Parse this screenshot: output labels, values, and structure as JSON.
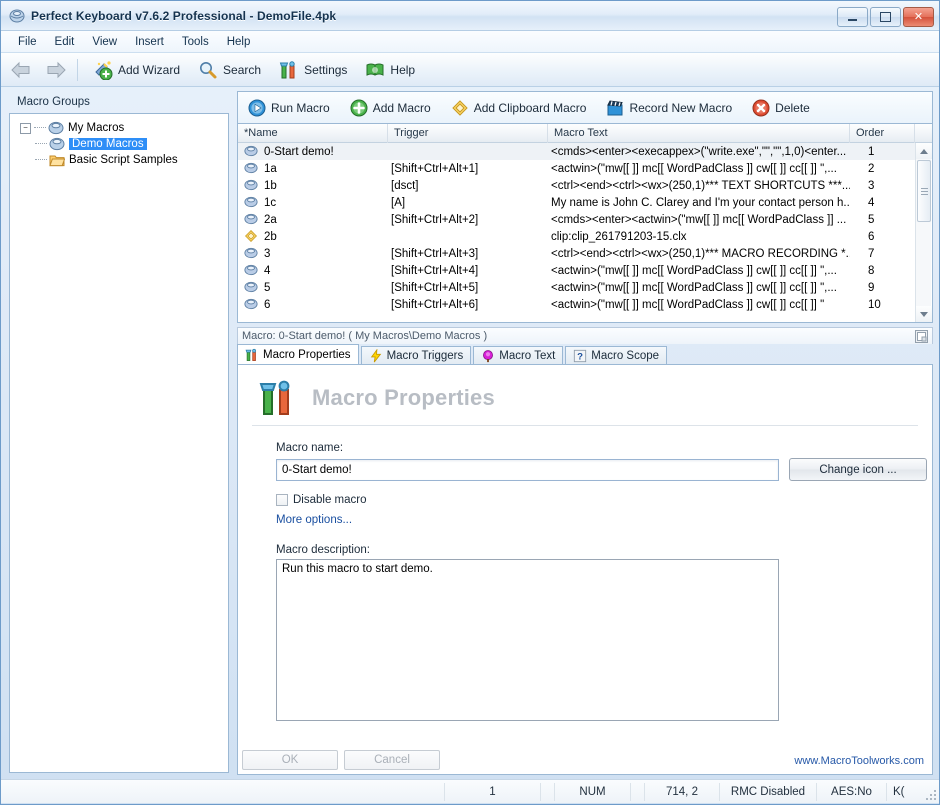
{
  "window": {
    "title": "Perfect Keyboard v7.6.2 Professional - DemoFile.4pk",
    "minimize_label": "Minimize",
    "maximize_label": "Maximize",
    "close_label": "✕"
  },
  "menu": {
    "items": [
      {
        "label": "File"
      },
      {
        "label": "Edit"
      },
      {
        "label": "View"
      },
      {
        "label": "Insert"
      },
      {
        "label": "Tools"
      },
      {
        "label": "Help"
      }
    ]
  },
  "toolbar": {
    "back_icon": "back-arrow-icon",
    "forward_icon": "forward-arrow-icon",
    "buttons": [
      {
        "label": "Add Wizard",
        "icon": "add-wizard-icon"
      },
      {
        "label": "Search",
        "icon": "magnifier-icon"
      },
      {
        "label": "Settings",
        "icon": "settings-tools-icon"
      },
      {
        "label": "Help",
        "icon": "help-book-icon"
      }
    ]
  },
  "sidebar": {
    "header": "Macro Groups",
    "tree": [
      {
        "label": "My Macros",
        "icon": "macro-group-icon",
        "level": 0,
        "expanded": true,
        "selected": false
      },
      {
        "label": "Demo Macros",
        "icon": "macro-group-icon",
        "level": 1,
        "expanded": false,
        "selected": true
      },
      {
        "label": "Basic Script Samples",
        "icon": "folder-icon",
        "level": 1,
        "expanded": false,
        "selected": false
      }
    ]
  },
  "list_toolbar": {
    "buttons": [
      {
        "label": "Run Macro",
        "icon": "play-icon"
      },
      {
        "label": "Add Macro",
        "icon": "add-plus-icon"
      },
      {
        "label": "Add Clipboard Macro",
        "icon": "clipboard-diamond-icon"
      },
      {
        "label": "Record New Macro",
        "icon": "record-clapper-icon"
      },
      {
        "label": "Delete",
        "icon": "delete-x-icon"
      }
    ]
  },
  "macro_list": {
    "columns": [
      "*Name",
      "Trigger",
      "Macro Text",
      "Order"
    ],
    "rows": [
      {
        "icon": "macro-cube-icon",
        "name": "0-Start demo!",
        "trigger": "",
        "text": "<cmds><enter><execappex>(\"write.exe\",\"\",\"\",1,0)<enter...",
        "order": "1",
        "selected": true
      },
      {
        "icon": "macro-cube-icon",
        "name": "1a",
        "trigger": "[Shift+Ctrl+Alt+1]",
        "text": "<actwin>(\"mw[[  ]] mc[[ WordPadClass ]] cw[[  ]] cc[[  ]] \",...",
        "order": "2",
        "selected": false
      },
      {
        "icon": "macro-cube-icon",
        "name": "1b",
        "trigger": "[dsct]",
        "text": "<ctrl><end><ctrl><wx>(250,1)*** TEXT SHORTCUTS ***...",
        "order": "3",
        "selected": false
      },
      {
        "icon": "macro-cube-icon",
        "name": "1c",
        "trigger": "[A]",
        "text": "My name is John C. Clarey and I'm your contact person h...",
        "order": "4",
        "selected": false
      },
      {
        "icon": "macro-cube-icon",
        "name": "2a",
        "trigger": "[Shift+Ctrl+Alt+2]",
        "text": "<cmds><enter><actwin>(\"mw[[  ]] mc[[ WordPadClass ]] ...",
        "order": "5",
        "selected": false
      },
      {
        "icon": "clipboard-diamond-icon",
        "name": "2b",
        "trigger": "",
        "text": "clip:clip_261791203-15.clx",
        "order": "6",
        "selected": false
      },
      {
        "icon": "macro-cube-icon",
        "name": "3",
        "trigger": "[Shift+Ctrl+Alt+3]",
        "text": "<ctrl><end><ctrl><wx>(250,1)*** MACRO RECORDING *...",
        "order": "7",
        "selected": false
      },
      {
        "icon": "macro-cube-icon",
        "name": "4",
        "trigger": "[Shift+Ctrl+Alt+4]",
        "text": "<actwin>(\"mw[[  ]] mc[[ WordPadClass ]] cw[[  ]] cc[[  ]] \",...",
        "order": "8",
        "selected": false
      },
      {
        "icon": "macro-cube-icon",
        "name": "5",
        "trigger": "[Shift+Ctrl+Alt+5]",
        "text": "<actwin>(\"mw[[  ]] mc[[ WordPadClass ]] cw[[  ]] cc[[  ]] \",...",
        "order": "9",
        "selected": false
      },
      {
        "icon": "macro-cube-icon",
        "name": "6",
        "trigger": "[Shift+Ctrl+Alt+6]",
        "text": "<actwin>(\"mw[[  ]] mc[[ WordPadClass ]] cw[[  ]] cc[[  ]] \"",
        "order": "10",
        "selected": false
      }
    ]
  },
  "properties": {
    "header": "Macro: 0-Start demo! ( My Macros\\Demo Macros )",
    "header_icon": "restore-panel-icon",
    "tabs": [
      {
        "label": "Macro Properties",
        "icon": "macro-properties-icon",
        "active": true
      },
      {
        "label": "Macro Triggers",
        "icon": "lightning-icon",
        "active": false
      },
      {
        "label": "Macro Text",
        "icon": "macro-text-icon",
        "active": false
      },
      {
        "label": "Macro Scope",
        "icon": "question-icon",
        "active": false
      }
    ],
    "page_title": "Macro Properties",
    "page_icon": "macro-properties-icon",
    "name_label": "Macro name:",
    "name_value": "0-Start demo!",
    "change_icon_label": "Change icon ...",
    "disable_label": "Disable macro",
    "disable_checked": false,
    "more_options_label": "More options...",
    "description_label": "Macro description:",
    "description_value": "Run this macro to start demo.",
    "ok_label": "OK",
    "cancel_label": "Cancel",
    "website": "www.MacroToolworks.com"
  },
  "statusbar": {
    "cells": [
      "",
      "1",
      "",
      "NUM",
      "",
      "714,  2",
      "RMC Disabled",
      "AES:No",
      "K("
    ]
  },
  "colors": {
    "accent": "#2e8ef7",
    "window_border": "#6d9bc9",
    "link": "#1a4fa0",
    "title_text": "#15334f"
  }
}
